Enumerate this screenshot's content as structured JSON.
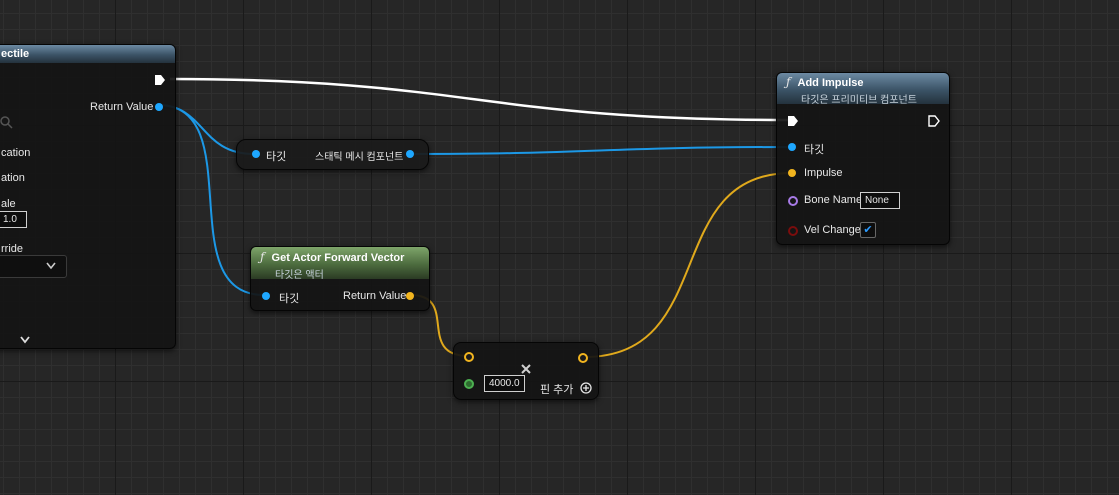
{
  "spawn_node": {
    "title_fragment": "ectile",
    "return_value_label": "Return Value",
    "rows": [
      "cation",
      "ation",
      "ale",
      "rride"
    ],
    "scale_value": "1.0"
  },
  "cast_node": {
    "in_label": "타깃",
    "out_label": "스태틱 메시 컴포넌트"
  },
  "forward_node": {
    "title": "Get Actor Forward Vector",
    "subtitle": "타깃은 액터",
    "target_label": "타깃",
    "return_label": "Return Value"
  },
  "multiply_node": {
    "value": "4000.0",
    "add_pin_label": "핀 추가"
  },
  "impulse_node": {
    "title": "Add Impulse",
    "subtitle": "타깃은 프리미티브 컴포넌트",
    "target_label": "타깃",
    "impulse_label": "Impulse",
    "bone_name_label": "Bone Name",
    "bone_name_value": "None",
    "vel_change_label": "Vel Change",
    "vel_change_checked": true
  },
  "colors": {
    "object_pin": "#1ea7ff",
    "vector_pin": "#f2b51f",
    "exec_wire": "#ffffff",
    "function_header_blue": "#3b5366",
    "function_header_green": "#4c6b3e"
  }
}
